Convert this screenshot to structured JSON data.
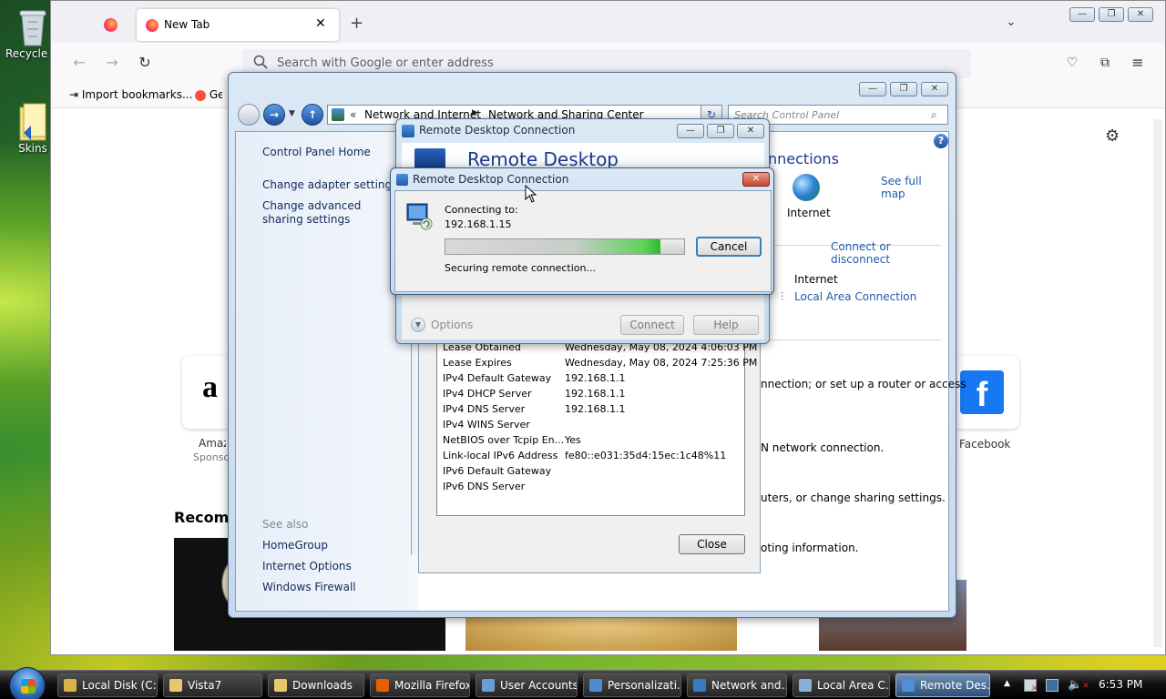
{
  "desktop": {
    "icons": [
      {
        "label": "Recycle Bin"
      },
      {
        "label": "Skins"
      }
    ]
  },
  "firefox": {
    "tab_title": "New Tab",
    "address_placeholder": "Search with Google or enter address",
    "bookmarks": [
      "Import bookmarks...",
      "Getting Started"
    ],
    "shortcuts": [
      {
        "label": "Amazon",
        "sub": "Sponsored"
      },
      {
        "label": "Facebook"
      }
    ],
    "recommended_heading": "Recommended by Pocket"
  },
  "cp": {
    "breadcrumb": [
      "Network and Internet",
      "Network and Sharing Center"
    ],
    "search_placeholder": "Search Control Panel",
    "sidebar": {
      "home": "Control Panel Home",
      "links": [
        "Change adapter settings",
        "Change advanced sharing settings"
      ],
      "see_also": "See also",
      "also_links": [
        "HomeGroup",
        "Internet Options",
        "Windows Firewall"
      ]
    },
    "heading_fragment": "nnections",
    "see_full_map": "See full map",
    "internet": "Internet",
    "connect_disconnect": "Connect or disconnect",
    "access_type": "Internet",
    "local_area": "Local Area Connection",
    "text1": "nnection; or set up a router or access",
    "text2": "N network connection.",
    "text3": "uters, or change sharing settings.",
    "text4": "oting information."
  },
  "details": {
    "rows": [
      {
        "k": "Lease Obtained",
        "v": "Wednesday, May 08, 2024 4:06:03 PM"
      },
      {
        "k": "Lease Expires",
        "v": "Wednesday, May 08, 2024 7:25:36 PM"
      },
      {
        "k": "IPv4 Default Gateway",
        "v": "192.168.1.1"
      },
      {
        "k": "IPv4 DHCP Server",
        "v": "192.168.1.1"
      },
      {
        "k": "IPv4 DNS Server",
        "v": "192.168.1.1"
      },
      {
        "k": "IPv4 WINS Server",
        "v": ""
      },
      {
        "k": "NetBIOS over Tcpip En...",
        "v": "Yes"
      },
      {
        "k": "Link-local IPv6 Address",
        "v": "fe80::e031:35d4:15ec:1c48%11"
      },
      {
        "k": "IPv6 Default Gateway",
        "v": ""
      },
      {
        "k": "IPv6 DNS Server",
        "v": ""
      }
    ],
    "close": "Close"
  },
  "rdc": {
    "title": "Remote Desktop Connection",
    "banner": "Remote Desktop",
    "options": "Options",
    "connect": "Connect",
    "help": "Help"
  },
  "conn": {
    "title": "Remote Desktop Connection",
    "connecting_to": "Connecting to:",
    "host": "192.168.1.15",
    "progress": 0.9,
    "status": "Securing remote connection...",
    "cancel": "Cancel"
  },
  "taskbar": {
    "items": [
      {
        "label": "Local Disk (C:)",
        "color": "#d9b24a"
      },
      {
        "label": "Vista7",
        "color": "#e8c96a"
      },
      {
        "label": "Downloads",
        "color": "#e8c96a"
      },
      {
        "label": "Mozilla Firefox",
        "color": "#e66000"
      },
      {
        "label": "User Accounts",
        "color": "#6a9fd6"
      },
      {
        "label": "Personalizati...",
        "color": "#4d8ad0"
      },
      {
        "label": "Network and...",
        "color": "#3a7ac0"
      },
      {
        "label": "Local Area C...",
        "color": "#8ab0d8"
      },
      {
        "label": "Remote Des...",
        "color": "#4f8fd8"
      }
    ],
    "clock": "6:53 PM"
  }
}
